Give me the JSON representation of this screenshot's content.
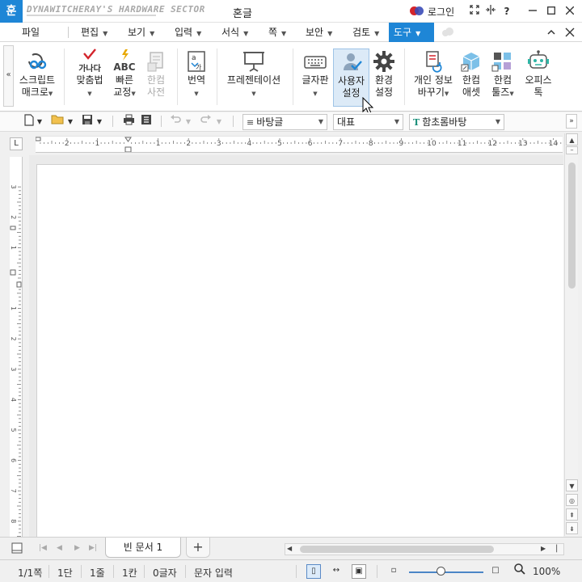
{
  "title_bar": {
    "app_icon": "hwp-app-icon",
    "watermark": "DYNAWITCHERAY'S HARDWARE SECTOR",
    "title": "혼글",
    "login_label": "로그인",
    "controls": [
      "fullscreen-icon",
      "split-icon",
      "help-icon",
      "minimize-icon",
      "maximize-icon",
      "close-icon"
    ]
  },
  "menu": {
    "file": "파일",
    "items": [
      "편집",
      "보기",
      "입력",
      "서식",
      "쪽",
      "보안",
      "검토"
    ],
    "active": "도구",
    "ribbon_close": "close-icon"
  },
  "ribbon": {
    "collapse_label": "«",
    "buttons": [
      {
        "line1": "스크립트",
        "line2": "매크로",
        "icon": "script-macro-icon",
        "dropdown": true,
        "enabled": true
      },
      {
        "line1": "맞춤법",
        "line2": "",
        "icon": "spellcheck-icon",
        "dropdown": true,
        "enabled": true,
        "icon_text": "가나다"
      },
      {
        "line1": "빠른",
        "line2": "교정",
        "icon": "quick-correct-icon",
        "dropdown": true,
        "enabled": true,
        "icon_text": "ABC"
      },
      {
        "line1": "한컴",
        "line2": "사전",
        "icon": "hancom-dictionary-icon",
        "dropdown": false,
        "enabled": false
      },
      {
        "line1": "번역",
        "line2": "",
        "icon": "translate-icon",
        "dropdown": true,
        "enabled": true
      },
      {
        "line1": "프레젠테이션",
        "line2": "",
        "icon": "presentation-icon",
        "dropdown": true,
        "enabled": true
      },
      {
        "line1": "글자판",
        "line2": "",
        "icon": "keyboard-icon",
        "dropdown": true,
        "enabled": true
      },
      {
        "line1": "사용자",
        "line2": "설정",
        "icon": "user-settings-icon",
        "dropdown": false,
        "enabled": true,
        "hover": true
      },
      {
        "line1": "환경",
        "line2": "설정",
        "icon": "gear-icon",
        "dropdown": false,
        "enabled": true
      },
      {
        "line1": "개인 정보",
        "line2": "바꾸기",
        "icon": "privacy-replace-icon",
        "dropdown": true,
        "enabled": true
      },
      {
        "line1": "한컴",
        "line2": "애셋",
        "icon": "hancom-asset-icon",
        "dropdown": false,
        "enabled": true
      },
      {
        "line1": "한컴",
        "line2": "툴즈",
        "icon": "hancom-tools-icon",
        "dropdown": true,
        "enabled": true
      },
      {
        "line1": "오피스",
        "line2": "톡",
        "icon": "office-talk-icon",
        "dropdown": false,
        "enabled": true
      }
    ]
  },
  "toolbar": {
    "style_select": "바탕글",
    "style_icon_text": "≡",
    "language_select": "대표",
    "font_select": "함초롬바탕",
    "font_icon_text": "T"
  },
  "ruler": {
    "h_labels": [
      "2",
      "1",
      "1",
      "2",
      "3",
      "4",
      "5",
      "6",
      "7",
      "8",
      "9",
      "10",
      "11",
      "12",
      "13",
      "14"
    ],
    "v_labels": [
      "3",
      "2",
      "1",
      "1",
      "2",
      "3",
      "4",
      "5",
      "6",
      "7",
      "8"
    ],
    "corner": "L"
  },
  "tabs": {
    "doc_tab": "빈 문서 1",
    "add": "+"
  },
  "status": {
    "page": "1/1쪽",
    "column": "1단",
    "line": "1줄",
    "col": "1칸",
    "chars": "0글자",
    "mode": "문자 입력",
    "zoom": "100%",
    "zoom_fraction": 0.42
  }
}
